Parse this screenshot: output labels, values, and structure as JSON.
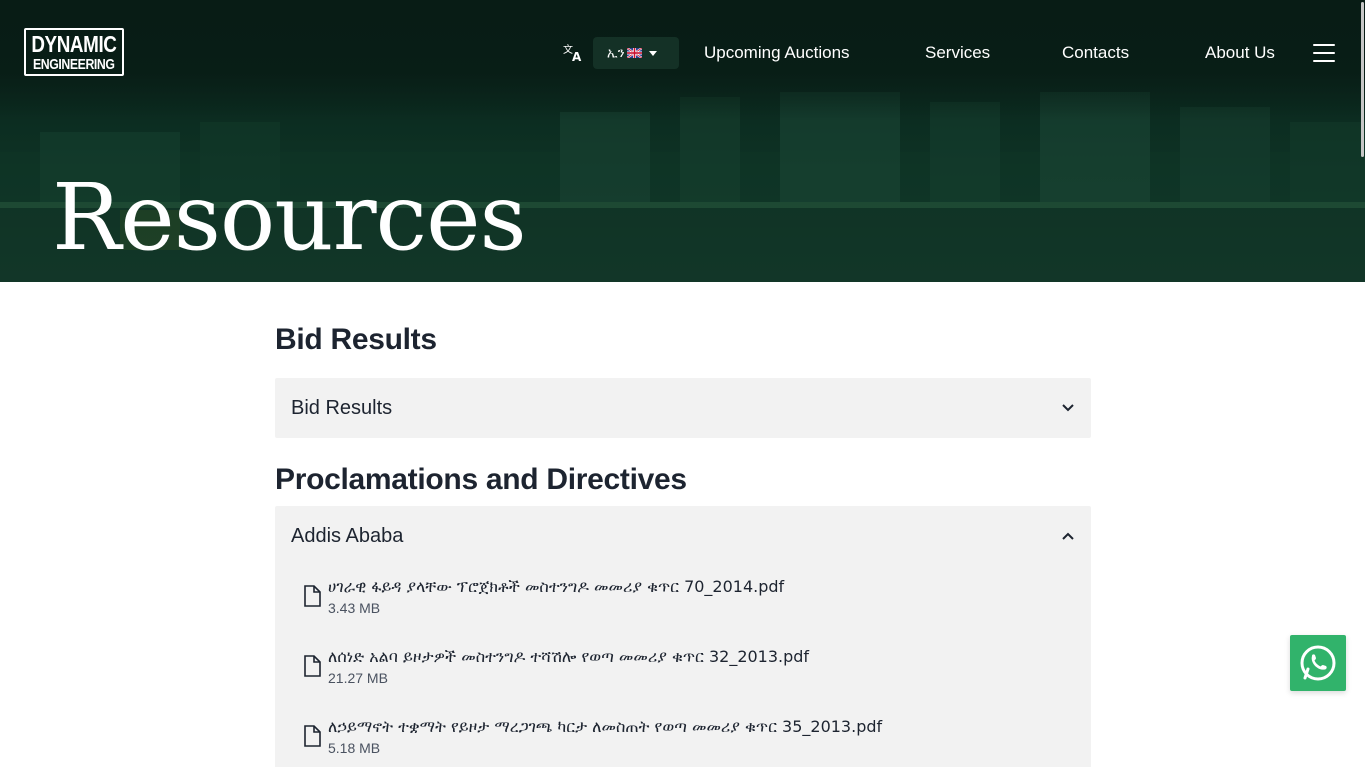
{
  "brand": {
    "line1": "DYNAMIC",
    "line2": "ENGINEERING"
  },
  "nav": {
    "language_label": "ኢን",
    "links": [
      "Upcoming Auctions",
      "Services",
      "Contacts",
      "About Us"
    ]
  },
  "hero": {
    "title": "Resources"
  },
  "sections": [
    {
      "title": "Bid Results",
      "accordion": {
        "label": "Bid Results",
        "expanded": false
      }
    },
    {
      "title": "Proclamations and Directives",
      "accordion": {
        "label": "Addis Ababa",
        "expanded": true,
        "files": [
          {
            "name": "ሀገራዊ ፋይዳ ያላቸው ፕሮጀክቶች መስተንግዶ መመሪያ ቁጥር 70_2014.pdf",
            "size": "3.43 MB"
          },
          {
            "name": "ለሰነድ አልባ ይዞታዎች መስተንግዶ ተሻሽሎ የወጣ መመሪያ ቁጥር 32_2013.pdf",
            "size": "21.27 MB"
          },
          {
            "name": "ለኃይማኖት ተቋማት የይዞታ ማረጋገጫ ካርታ ለመስጠት የወጣ መመሪያ ቁጥር 35_2013.pdf",
            "size": "5.18 MB"
          }
        ]
      }
    }
  ],
  "colors": {
    "hero_bg": "#0b2a1f",
    "accordion_bg": "#f2f2f2",
    "whatsapp": "#31b36b"
  },
  "icons": {
    "translate": "translate-icon",
    "chevron_down": "chevron-down-icon",
    "chevron_up": "chevron-up-icon",
    "file": "file-icon",
    "whatsapp": "whatsapp-icon",
    "menu": "hamburger-menu-icon"
  }
}
